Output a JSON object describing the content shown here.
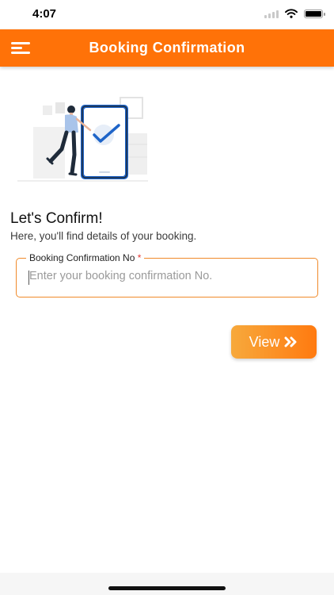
{
  "status_bar": {
    "time": "4:07"
  },
  "app_bar": {
    "title": "Booking Confirmation",
    "menu_icon": "hamburger-menu-icon"
  },
  "illustration": {
    "icon": "phone-checkmark-illustration"
  },
  "content": {
    "heading": "Let's Confirm!",
    "subheading": "Here, you'll find details of your booking."
  },
  "form": {
    "field_label": "Booking Confirmation No",
    "required_marker": "*",
    "placeholder": "Enter your booking confirmation No.",
    "value": ""
  },
  "actions": {
    "view_label": "View",
    "view_icon": "double-chevron-right-icon"
  },
  "colors": {
    "brand": "#ff7208",
    "field_border": "#f08a2a",
    "required": "#e53935"
  }
}
